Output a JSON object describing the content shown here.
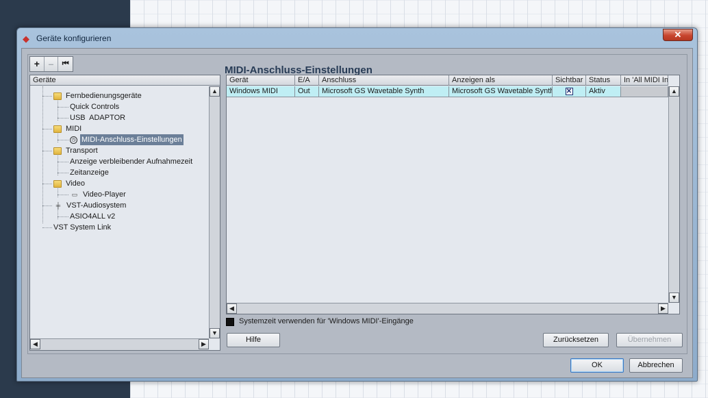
{
  "window": {
    "title": "Geräte konfigurieren",
    "close_glyph": "✕"
  },
  "toolbar": {
    "add": "+",
    "remove": "–",
    "reset": "⏮"
  },
  "section_title": "MIDI-Anschluss-Einstellungen",
  "tree": {
    "header": "Geräte",
    "items": [
      {
        "label": "Fernbedienungsgeräte",
        "icon": "folder-icon"
      },
      {
        "label": "Quick Controls"
      },
      {
        "label": "USB  ADAPTOR"
      },
      {
        "label": "MIDI",
        "icon": "folder-icon"
      },
      {
        "label": "MIDI-Anschluss-Einstellungen",
        "icon": "clock-icon",
        "selected": true
      },
      {
        "label": "Transport",
        "icon": "folder-icon"
      },
      {
        "label": "Anzeige verbleibender Aufnahmezeit"
      },
      {
        "label": "Zeitanzeige"
      },
      {
        "label": "Video",
        "icon": "folder-icon"
      },
      {
        "label": "Video-Player",
        "icon": "video-icon"
      },
      {
        "label": "VST-Audiosystem",
        "icon": "audio-icon"
      },
      {
        "label": "ASIO4ALL v2"
      },
      {
        "label": "VST System Link"
      }
    ]
  },
  "table": {
    "columns": [
      "Gerät",
      "E/A",
      "Anschluss",
      "Anzeigen als",
      "Sichtbar",
      "Status",
      "In 'All MIDI In"
    ],
    "rows": [
      {
        "geraet": "Windows MIDI",
        "ea": "Out",
        "anschluss": "Microsoft GS Wavetable Synth",
        "anzeigen": "Microsoft GS Wavetable Synth",
        "sichtbar": "✕",
        "status": "Aktiv",
        "allmidi": ""
      }
    ]
  },
  "system_time_label": "Systemzeit verwenden für 'Windows MIDI'-Eingänge",
  "buttons": {
    "help": "Hilfe",
    "reset": "Zurücksetzen",
    "apply": "Übernehmen",
    "ok": "OK",
    "cancel": "Abbrechen"
  },
  "scroll_glyphs": {
    "up": "▲",
    "down": "▼",
    "left": "◀",
    "right": "▶"
  },
  "colors": {
    "selected_row": "#bfeef4",
    "tree_selection": "#6b7f98",
    "title_blue": "#283c56"
  }
}
